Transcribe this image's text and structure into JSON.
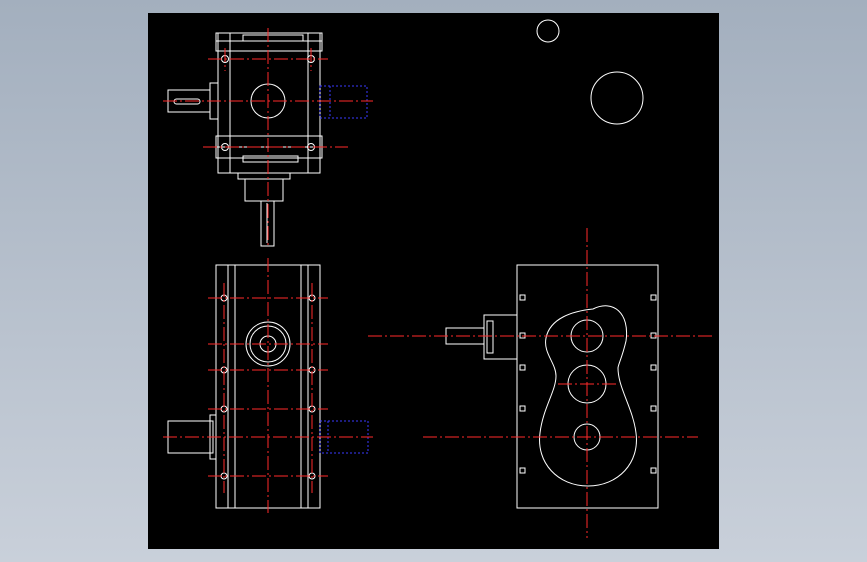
{
  "drawing": {
    "background": "#000000",
    "line_color": "#ffffff",
    "centerline_color": "#ff2a2a",
    "hidden_line_color": "#3a3aff",
    "views": [
      "top-view",
      "front-view",
      "side-view"
    ]
  }
}
